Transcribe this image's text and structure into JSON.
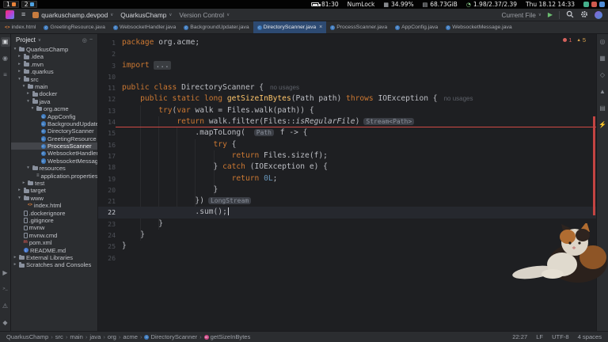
{
  "system_bar": {
    "workspaces": [
      {
        "num": "1",
        "icon_color": "#e8833a"
      },
      {
        "num": "2",
        "icon_color": "#4fa3e3"
      }
    ],
    "battery_time": "81:30",
    "numlock": "NumLock",
    "cpu": "34.99%",
    "disk": "68.73GiB",
    "load": "1.98/2.37/2.39",
    "datetime": "Thu 18.12 14:33",
    "tray": [
      {
        "name": "tray-icon-1",
        "color": "#45b08c"
      },
      {
        "name": "tray-icon-2",
        "color": "#d05a4e"
      },
      {
        "name": "tray-icon-3",
        "color": "#4f8cd6"
      }
    ]
  },
  "title_bar": {
    "devpod_label": "quarkuschamp.devpod",
    "project_label": "QuarkusChamp",
    "vcs_label": "Version Control",
    "run_config_label": "Current File",
    "run_icon_glyph": "▶"
  },
  "editor_tabs": [
    {
      "label": "index.html",
      "icon": "html",
      "active": false
    },
    {
      "label": "GreetingResource.java",
      "icon": "class",
      "active": false
    },
    {
      "label": "WebsocketHandler.java",
      "icon": "class",
      "active": false
    },
    {
      "label": "BackgroundUpdater.java",
      "icon": "class",
      "active": false
    },
    {
      "label": "DirectoryScanner.java",
      "icon": "class",
      "active": true
    },
    {
      "label": "ProcessScanner.java",
      "icon": "class",
      "active": false
    },
    {
      "label": "AppConfig.java",
      "icon": "class",
      "active": false
    },
    {
      "label": "WebsocketMessage.java",
      "icon": "class",
      "active": false
    }
  ],
  "inspections": {
    "errors": "1",
    "warnings": "5"
  },
  "left_stripe": [
    {
      "name": "project-icon",
      "glyph": "▣",
      "active": true
    },
    {
      "name": "commit-icon",
      "glyph": "◉"
    },
    {
      "name": "structure-icon",
      "glyph": "≡"
    }
  ],
  "left_stripe_bottom": [
    {
      "name": "run-tool-icon",
      "glyph": "▶"
    },
    {
      "name": "terminal-icon",
      "glyph": ">_"
    },
    {
      "name": "problems-icon",
      "glyph": "⚠"
    },
    {
      "name": "services-icon",
      "glyph": "◆"
    }
  ],
  "right_stripe": [
    {
      "name": "notifications-icon",
      "glyph": "◎"
    },
    {
      "name": "build-icon",
      "glyph": "▦"
    },
    {
      "name": "gradle-icon",
      "glyph": "◇"
    },
    {
      "name": "maven-icon",
      "glyph": "▲"
    },
    {
      "name": "database-icon",
      "glyph": "▤"
    },
    {
      "name": "endpoints-icon",
      "glyph": "⚡"
    }
  ],
  "project_panel": {
    "title": "Project",
    "header_icons": [
      {
        "name": "locate-file-icon",
        "glyph": "◎"
      },
      {
        "name": "hide-panel-icon",
        "glyph": "−"
      }
    ],
    "tree": [
      {
        "label": "QuarkusChamp",
        "level": 0,
        "icon": "folder",
        "exp": "open"
      },
      {
        "label": ".idea",
        "level": 1,
        "icon": "folder",
        "exp": "closed"
      },
      {
        "label": ".mvn",
        "level": 1,
        "icon": "folder",
        "exp": "closed"
      },
      {
        "label": ".quarkus",
        "level": 1,
        "icon": "folder",
        "exp": "closed"
      },
      {
        "label": "src",
        "level": 1,
        "icon": "folder",
        "exp": "open"
      },
      {
        "label": "main",
        "level": 2,
        "icon": "folder",
        "exp": "open"
      },
      {
        "label": "docker",
        "level": 3,
        "icon": "folder",
        "exp": "closed"
      },
      {
        "label": "java",
        "level": 3,
        "icon": "folder",
        "exp": "open"
      },
      {
        "label": "org.acme",
        "level": 4,
        "icon": "folder",
        "exp": "open"
      },
      {
        "label": "AppConfig",
        "level": 5,
        "icon": "class",
        "exp": "none"
      },
      {
        "label": "BackgroundUpdater",
        "level": 5,
        "icon": "class",
        "exp": "none"
      },
      {
        "label": "DirectoryScanner",
        "level": 5,
        "icon": "class",
        "exp": "none"
      },
      {
        "label": "GreetingResource",
        "level": 5,
        "icon": "class",
        "exp": "none"
      },
      {
        "label": "ProcessScanner",
        "level": 5,
        "icon": "class",
        "exp": "none",
        "selected": true
      },
      {
        "label": "WebsocketHandler",
        "level": 5,
        "icon": "class",
        "exp": "none"
      },
      {
        "label": "WebsocketMessage",
        "level": 5,
        "icon": "class",
        "exp": "none"
      },
      {
        "label": "resources",
        "level": 3,
        "icon": "folder",
        "exp": "open"
      },
      {
        "label": "application.properties",
        "level": 4,
        "icon": "props",
        "exp": "none"
      },
      {
        "label": "test",
        "level": 2,
        "icon": "folder",
        "exp": "closed"
      },
      {
        "label": "target",
        "level": 1,
        "icon": "folder",
        "exp": "closed"
      },
      {
        "label": "www",
        "level": 1,
        "icon": "folder",
        "exp": "open"
      },
      {
        "label": "index.html",
        "level": 2,
        "icon": "html",
        "exp": "none"
      },
      {
        "label": ".dockerignore",
        "level": 1,
        "icon": "file",
        "exp": "none"
      },
      {
        "label": ".gitignore",
        "level": 1,
        "icon": "file",
        "exp": "none"
      },
      {
        "label": "mvnw",
        "level": 1,
        "icon": "file",
        "exp": "none"
      },
      {
        "label": "mvnw.cmd",
        "level": 1,
        "icon": "file",
        "exp": "none"
      },
      {
        "label": "pom.xml",
        "level": 1,
        "icon": "maven",
        "exp": "none"
      },
      {
        "label": "README.md",
        "level": 1,
        "icon": "readme",
        "exp": "none"
      },
      {
        "label": "External Libraries",
        "level": 0,
        "icon": "folder",
        "exp": "closed"
      },
      {
        "label": "Scratches and Consoles",
        "level": 0,
        "icon": "folder",
        "exp": "closed"
      }
    ]
  },
  "editor": {
    "current_line": "22",
    "error_line": "14",
    "lines": [
      {
        "num": "1",
        "segs": [
          {
            "t": "package",
            "c": "kw"
          },
          {
            "t": " org.acme;",
            "c": "pl"
          }
        ]
      },
      {
        "num": "2",
        "segs": []
      },
      {
        "num": "3",
        "segs": [
          {
            "t": "import ",
            "c": "kw"
          },
          {
            "t": "...",
            "c": "fold"
          }
        ]
      },
      {
        "num": "10",
        "segs": []
      },
      {
        "num": "11",
        "segs": [
          {
            "t": "public class",
            "c": "kw"
          },
          {
            "t": " DirectoryScanner {",
            "c": "pl"
          },
          {
            "t": "no usages",
            "c": "hint"
          }
        ]
      },
      {
        "num": "12",
        "segs": [
          {
            "t": "    ",
            "c": "pl"
          },
          {
            "t": "public static long",
            "c": "kw"
          },
          {
            "t": " ",
            "c": "pl"
          },
          {
            "t": "getSizeInBytes",
            "c": "mth"
          },
          {
            "t": "(Path path) ",
            "c": "pl"
          },
          {
            "t": "throws",
            "c": "kw"
          },
          {
            "t": " IOException {",
            "c": "pl"
          },
          {
            "t": "no usages",
            "c": "hint"
          }
        ]
      },
      {
        "num": "13",
        "segs": [
          {
            "t": "        ",
            "c": "pl"
          },
          {
            "t": "try",
            "c": "kw"
          },
          {
            "t": "(",
            "c": "pl"
          },
          {
            "t": "var",
            "c": "kw"
          },
          {
            "t": " walk = Files.walk(path)) {",
            "c": "pl"
          }
        ]
      },
      {
        "num": "14",
        "segs": [
          {
            "t": "            ",
            "c": "pl"
          },
          {
            "t": "return",
            "c": "kw"
          },
          {
            "t": " walk.filter(Files::",
            "c": "pl"
          },
          {
            "t": "isRegularFile",
            "c": "it"
          },
          {
            "t": ")",
            "c": "pl"
          },
          {
            "t": "Stream<Path>",
            "c": "chip"
          }
        ]
      },
      {
        "num": "15",
        "segs": [
          {
            "t": "                .mapToLong( ",
            "c": "pl"
          },
          {
            "t": "Path",
            "c": "chip"
          },
          {
            "t": " f -> {",
            "c": "pl"
          }
        ]
      },
      {
        "num": "16",
        "segs": [
          {
            "t": "                    ",
            "c": "pl"
          },
          {
            "t": "try",
            "c": "kw"
          },
          {
            "t": " {",
            "c": "pl"
          }
        ]
      },
      {
        "num": "17",
        "segs": [
          {
            "t": "                        ",
            "c": "pl"
          },
          {
            "t": "return",
            "c": "kw"
          },
          {
            "t": " Files.size(f);",
            "c": "pl"
          }
        ]
      },
      {
        "num": "18",
        "segs": [
          {
            "t": "                    } ",
            "c": "pl"
          },
          {
            "t": "catch",
            "c": "kw"
          },
          {
            "t": " (IOException e) {",
            "c": "pl"
          }
        ]
      },
      {
        "num": "19",
        "segs": [
          {
            "t": "                        ",
            "c": "pl"
          },
          {
            "t": "return",
            "c": "kw"
          },
          {
            "t": " ",
            "c": "pl"
          },
          {
            "t": "0L",
            "c": "num"
          },
          {
            "t": ";",
            "c": "pl"
          }
        ]
      },
      {
        "num": "20",
        "segs": [
          {
            "t": "                    }",
            "c": "pl"
          }
        ]
      },
      {
        "num": "21",
        "segs": [
          {
            "t": "                })",
            "c": "pl"
          },
          {
            "t": "LongStream",
            "c": "chip"
          }
        ]
      },
      {
        "num": "22",
        "caret": true,
        "segs": [
          {
            "t": "                .sum();",
            "c": "pl"
          }
        ]
      },
      {
        "num": "23",
        "segs": [
          {
            "t": "        }",
            "c": "pl"
          }
        ]
      },
      {
        "num": "24",
        "segs": [
          {
            "t": "    }",
            "c": "pl"
          }
        ]
      },
      {
        "num": "25",
        "segs": [
          {
            "t": "}",
            "c": "pl"
          }
        ]
      },
      {
        "num": "26",
        "segs": []
      }
    ]
  },
  "nav_bar": {
    "crumbs": [
      {
        "label": "QuarkusChamp"
      },
      {
        "label": "src"
      },
      {
        "label": "main"
      },
      {
        "label": "java"
      },
      {
        "label": "org"
      },
      {
        "label": "acme"
      },
      {
        "label": "DirectoryScanner",
        "icon": "class"
      },
      {
        "label": "getSizeInBytes",
        "icon": "method"
      }
    ],
    "caret": "22:27",
    "line_sep": "LF",
    "encoding": "UTF-8",
    "indent": "4 spaces"
  }
}
